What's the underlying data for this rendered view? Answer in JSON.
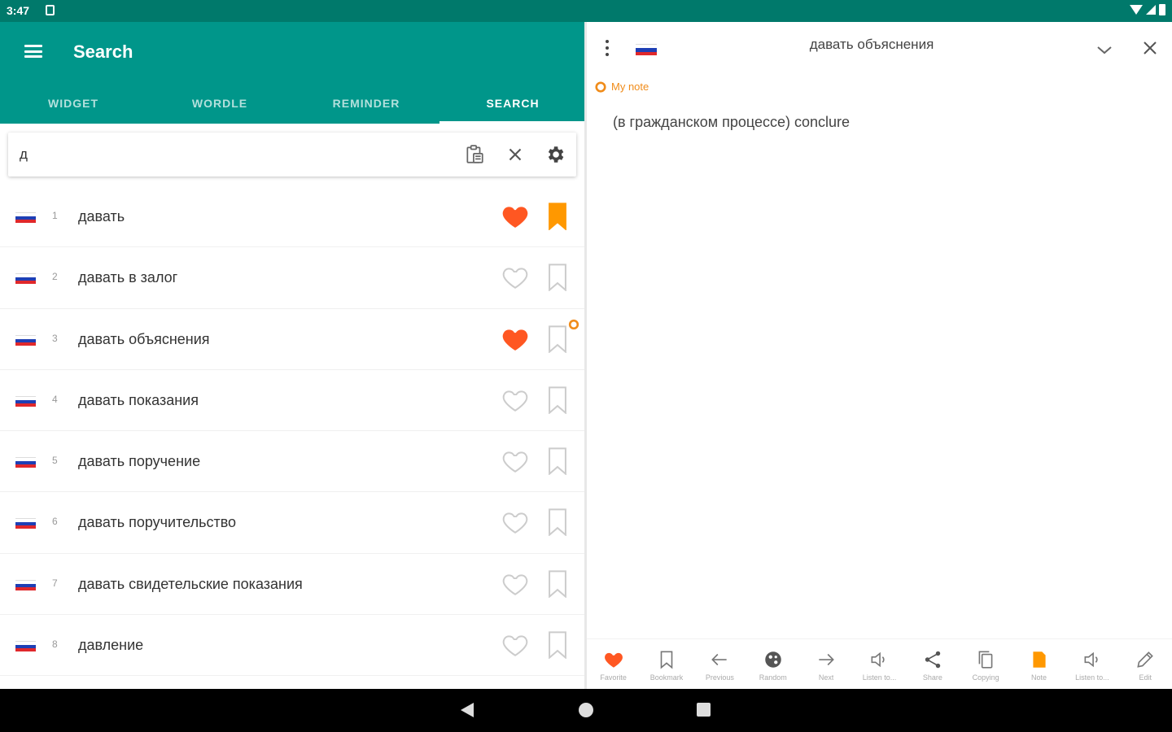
{
  "status_bar": {
    "time": "3:47"
  },
  "app_bar": {
    "title": "Search"
  },
  "tabs": [
    {
      "label": "WIDGET",
      "active": false
    },
    {
      "label": "WORDLE",
      "active": false
    },
    {
      "label": "REMINDER",
      "active": false
    },
    {
      "label": "SEARCH",
      "active": true
    }
  ],
  "search": {
    "value": "д",
    "placeholder": ""
  },
  "results": [
    {
      "num": "1",
      "word": "давать",
      "favorite": true,
      "bookmarked": true,
      "has_note": false
    },
    {
      "num": "2",
      "word": "давать в залог",
      "favorite": false,
      "bookmarked": false,
      "has_note": false
    },
    {
      "num": "3",
      "word": "давать объяснения",
      "favorite": true,
      "bookmarked": false,
      "has_note": true
    },
    {
      "num": "4",
      "word": "давать показания",
      "favorite": false,
      "bookmarked": false,
      "has_note": false
    },
    {
      "num": "5",
      "word": "давать поручение",
      "favorite": false,
      "bookmarked": false,
      "has_note": false
    },
    {
      "num": "6",
      "word": "давать поручительство",
      "favorite": false,
      "bookmarked": false,
      "has_note": false
    },
    {
      "num": "7",
      "word": "давать свидетельские показания",
      "favorite": false,
      "bookmarked": false,
      "has_note": false
    },
    {
      "num": "8",
      "word": "давление",
      "favorite": false,
      "bookmarked": false,
      "has_note": false
    }
  ],
  "detail": {
    "title": "давать объяснения",
    "note_label": "My note",
    "definition": "(в гражданском процессе) conclure"
  },
  "toolbar": [
    {
      "label": "Favorite",
      "icon": "heart-filled-icon"
    },
    {
      "label": "Bookmark",
      "icon": "bookmark-icon"
    },
    {
      "label": "Previous",
      "icon": "arrow-left-icon"
    },
    {
      "label": "Random",
      "icon": "random-icon"
    },
    {
      "label": "Next",
      "icon": "arrow-right-icon"
    },
    {
      "label": "Listen to...",
      "icon": "speaker-icon"
    },
    {
      "label": "Share",
      "icon": "share-icon"
    },
    {
      "label": "Copying",
      "icon": "copy-icon"
    },
    {
      "label": "Note",
      "icon": "note-icon"
    },
    {
      "label": "Listen to...",
      "icon": "speaker-icon"
    },
    {
      "label": "Edit",
      "icon": "pencil-icon"
    }
  ],
  "colors": {
    "primary": "#00968a",
    "status_bar": "#00796b",
    "favorite": "#ff5722",
    "bookmark": "#ff9800",
    "note": "#f08c1a"
  }
}
